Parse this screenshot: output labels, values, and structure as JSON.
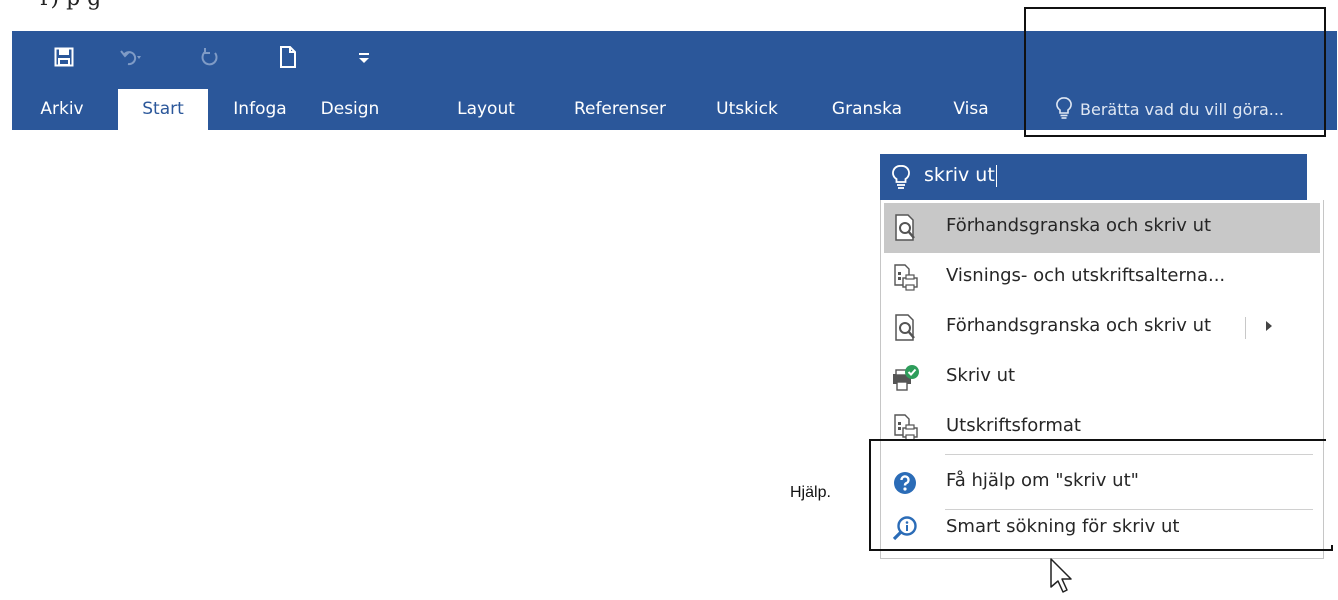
{
  "top_fragment": "r) p   g",
  "ribbon": {
    "qat": [
      {
        "name": "save-icon",
        "glyph": "💾"
      },
      {
        "name": "undo-icon",
        "glyph": "↶"
      },
      {
        "name": "redo-icon",
        "glyph": "↻"
      },
      {
        "name": "new-document-icon",
        "glyph": "🗋"
      },
      {
        "name": "customize-qat-icon",
        "glyph": "="
      }
    ],
    "tabs": [
      "Arkiv",
      "Start",
      "Infoga",
      "Design",
      "Layout",
      "Referenser",
      "Utskick",
      "Granska",
      "Visa"
    ],
    "active_tab": "Start",
    "tell_me_placeholder": "Berätta vad du vill göra..."
  },
  "search": {
    "query": "skriv ut",
    "results": [
      {
        "label": "Förhandsgranska och skriv ut",
        "icon": "print-preview-icon",
        "highlighted": true
      },
      {
        "label": "Visnings- och utskriftsalterna...",
        "icon": "print-options-icon"
      },
      {
        "label": "Förhandsgranska och skriv ut",
        "icon": "print-preview-icon",
        "submenu": true
      },
      {
        "label": "Skriv ut",
        "icon": "print-check-icon"
      },
      {
        "label": "Utskriftsformat",
        "icon": "print-layout-icon"
      }
    ],
    "help": [
      {
        "label": "Få hjälp om \"skriv ut\"",
        "icon": "help-icon"
      },
      {
        "label": "Smart sökning för skriv ut",
        "icon": "smart-lookup-icon"
      }
    ]
  },
  "annotation": "Hjälp.",
  "colors": {
    "ribbon": "#2b579a",
    "highlight": "#c8c8c8"
  }
}
